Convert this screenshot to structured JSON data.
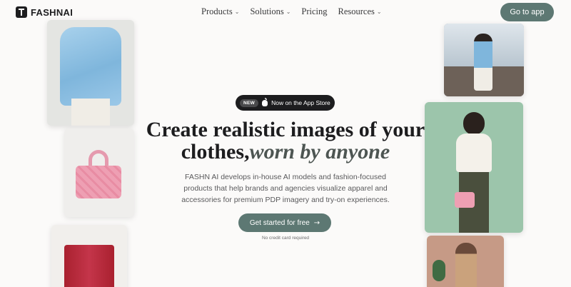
{
  "nav": {
    "brand": "FASHNAI",
    "links": [
      {
        "label": "Products",
        "chevron": "⌄"
      },
      {
        "label": "Solutions",
        "chevron": "⌄"
      },
      {
        "label": "Pricing",
        "chevron": ""
      },
      {
        "label": "Resources",
        "chevron": "⌄"
      }
    ],
    "cta": "Go to app"
  },
  "hero": {
    "badge": {
      "tag": "NEW",
      "icon": "apple-icon",
      "text": "Now on the App Store"
    },
    "headline_plain": "Create realistic images of your clothes,",
    "headline_italic": "worn by anyone",
    "description": "FASHN AI develops in-house AI models and fashion-focused products that help brands and agencies visualize apparel and accessories for premium PDP imagery and try-on experiences.",
    "cta": "Get started for free",
    "cta_icon": "→",
    "note": "No credit card required"
  },
  "colors": {
    "accent": "#5d7873",
    "dark": "#1d1d1f",
    "background": "#fbfaf9"
  }
}
